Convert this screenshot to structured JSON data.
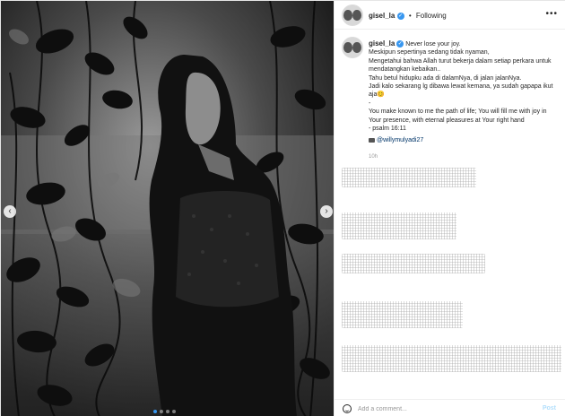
{
  "post": {
    "username": "gisel_la",
    "verified_icon": "verified-badge-icon",
    "separator": "•",
    "follow_status": "Following",
    "more_icon": "•••",
    "caption": {
      "line1": "Never lose your joy.",
      "line2": "Meskipun sepertinya sedang tidak nyaman,",
      "line3": "Mengetahui bahwa Allah turut bekerja dalam setiap perkara untuk",
      "line4": "mendatangkan kebaikan..",
      "line5": "Tahu betul hidupku ada di dalamNya, di jalan jalanNya.",
      "line6": "Jadi kalo sekarang lg dibawa lewat kemana, ya sudah gapapa ikut",
      "line7": "aja😊",
      "line8": "-",
      "line9": "You make known to me the path of life; You will fill me with joy in",
      "line10": "Your presence, with eternal pleasures at Your right hand",
      "line11": "- psalm 16:11",
      "credit_icon": "camera-emoji-icon",
      "credit": "@willymulyadi27"
    },
    "time_ago": "10h"
  },
  "carousel": {
    "prev_icon": "‹",
    "next_icon": "›",
    "slide_count": 4,
    "active_slide": 1
  },
  "comment_box": {
    "placeholder": "Add a comment...",
    "post_label": "Post",
    "emoji_icon": "smile-icon"
  },
  "colors": {
    "accent": "#3897f0",
    "post_disabled": "#b2dffc",
    "border": "#efefef"
  }
}
